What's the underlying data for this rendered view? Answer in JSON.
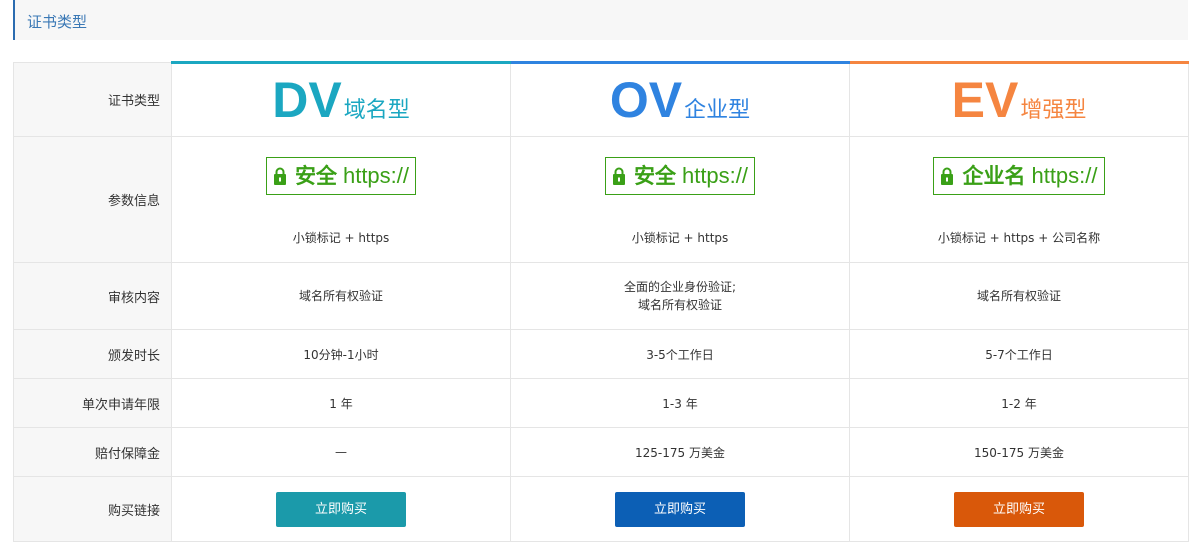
{
  "section": {
    "title": "证书类型"
  },
  "rows": {
    "type_label": "证书类型",
    "param_label": "参数信息",
    "audit_label": "审核内容",
    "time_label": "颁发时长",
    "year_label": "单次申请年限",
    "warranty_label": "赔付保障金",
    "buy_label": "购买链接"
  },
  "certs": [
    {
      "abbr": "DV",
      "sub": "域名型",
      "color": "#1ba7c1",
      "badge_label": "安全",
      "badge_protocol": "https://",
      "param_desc": "小锁标记 + https",
      "audit_line1": "域名所有权验证",
      "audit_line2": "",
      "time": "10分钟-1小时",
      "years": "1 年",
      "warranty": "—",
      "buy": "立即购买",
      "button_color": "#1b9aaa"
    },
    {
      "abbr": "OV",
      "sub": "企业型",
      "color": "#2f83e0",
      "badge_label": "安全",
      "badge_protocol": "https://",
      "param_desc": "小锁标记 + https",
      "audit_line1": "全面的企业身份验证;",
      "audit_line2": "域名所有权验证",
      "time": "3-5个工作日",
      "years": "1-3 年",
      "warranty": "125-175 万美金",
      "buy": "立即购买",
      "button_color": "#0c5fb5"
    },
    {
      "abbr": "EV",
      "sub": "增强型",
      "color": "#f58540",
      "badge_label": "企业名",
      "badge_protocol": "https://",
      "param_desc": "小锁标记 + https + 公司名称",
      "audit_line1": "域名所有权验证",
      "audit_line2": "",
      "time": "5-7个工作日",
      "years": "1-2 年",
      "warranty": "150-175 万美金",
      "buy": "立即购买",
      "button_color": "#d9580a"
    }
  ],
  "badge_color": "#3aa017"
}
